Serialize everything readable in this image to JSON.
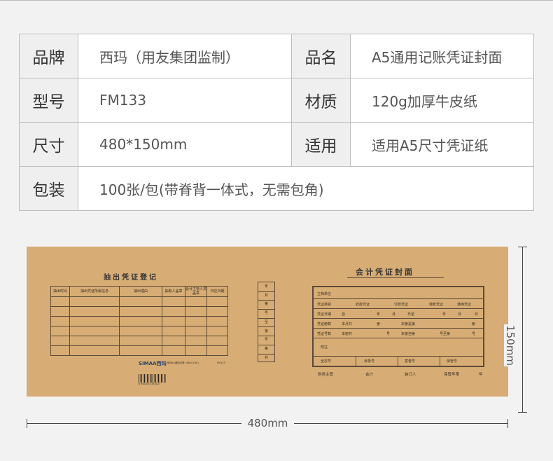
{
  "spec_table": {
    "rows": [
      {
        "k1": "品牌",
        "v1": "西玛（用友集团监制）",
        "k2": "品名",
        "v2": "A5通用记账凭证封面"
      },
      {
        "k1": "型号",
        "v1": "FM133",
        "k2": "材质",
        "v2": "120g加厚牛皮纸"
      },
      {
        "k1": "尺寸",
        "v1": "480*150mm",
        "k2": "适用",
        "v2": "适用A5尺寸凭证纸"
      },
      {
        "k1": "包装",
        "v1": "100张/包(带脊背一体式，无需包角)"
      }
    ]
  },
  "cover": {
    "left_title": "抽出凭证登记",
    "left_headers": [
      "抽出时间",
      "抽出凭证所属信息",
      "抽出理由",
      "抽取人盖章",
      "会计主管人员盖章",
      "归还日期"
    ],
    "brand": "SIMAA西玛",
    "product_lines": [
      "西玛A5通用记账 (480×150)",
      "FM133"
    ],
    "barcode_number": "6 941540 333127",
    "spine_cells": [
      "年",
      "月",
      "第",
      "号",
      "至",
      "第",
      "号",
      "第",
      "册",
      "共",
      "册"
    ],
    "right_title": "会计凭证封面",
    "form_labels": {
      "r1": "立档单位",
      "r2": "凭证类别",
      "r2_opts": [
        "收款凭证",
        "付款凭证",
        "转账凭证",
        "通用凭证"
      ],
      "r3": "凭证日期",
      "r3_parts": [
        "自",
        "年",
        "月",
        "日至",
        "年",
        "月",
        "日"
      ],
      "r4": "凭证册数",
      "r4_parts": [
        "本月共",
        "册",
        "本册是第",
        "册"
      ],
      "r5": "凭证号数",
      "r5_parts": [
        "本册共",
        "号",
        "本册自第",
        "号至第",
        "号"
      ],
      "r6": "附注",
      "r7": [
        "全宗号",
        "目录号",
        "案卷号",
        "保管号"
      ]
    },
    "footer": [
      "财务主管",
      "会计",
      "装订人",
      "保管年限",
      "年"
    ]
  },
  "dimensions": {
    "height_label": "150mm",
    "width_label": "480mm"
  }
}
